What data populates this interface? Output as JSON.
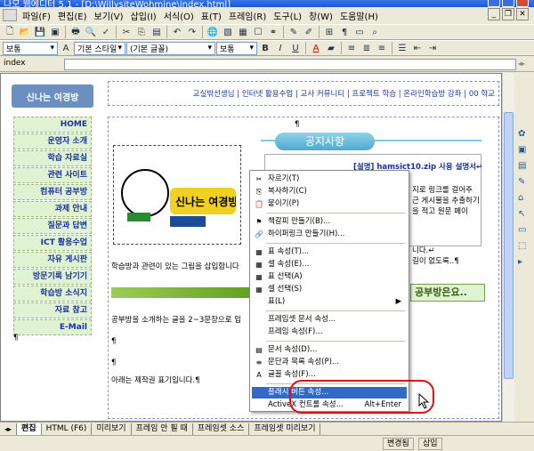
{
  "window": {
    "title": "나모 웹에디터 5.1 - [D:\\WillysiteWohmine\\index.html]"
  },
  "menu": [
    "파일(F)",
    "편집(E)",
    "보기(V)",
    "삽입(I)",
    "서식(O)",
    "표(T)",
    "프레임(R)",
    "도구(L)",
    "창(W)",
    "도움말(H)"
  ],
  "format": {
    "style": "보통",
    "font_style": "기본 스타일",
    "font": "(기본 글꼴)",
    "size": "보통",
    "bold": "B",
    "italic": "I",
    "underline": "U",
    "text_color": "A"
  },
  "address": {
    "name": "index"
  },
  "site": {
    "logo": "신나는 여경방",
    "topnav": "교실밖선생님 | 인터넷 활용수업 | 교사 커뮤니티 | 프로젝트 학습 | 온라인학습방 강좌 | 00 학교",
    "nav": [
      "HOME",
      "운영자 소개",
      "학습 자료실",
      "관련 사이트",
      "컴퓨터 공부방",
      "과제 안내",
      "질문과 답변",
      "ICT 활용수업",
      "자유 게시판",
      "방문기록 남기기",
      "학습방 소식지",
      "자료 참고",
      "E-Mail"
    ],
    "img_caption": "신나는 여경방",
    "notice_title": "공지사항",
    "notice_heading": "[설명] hamsict10.zip 사용 설명서↵",
    "notice_lines": [
      "지로 링크를 걸어주",
      "근 게시물을 추출하기",
      "을 적고 원문 페이",
      "니다.↵",
      "길이 없도록..¶"
    ],
    "text_img": "학습방과 관련이 있는 그림을 삽입합니다",
    "text_intro": "공부방을 소개하는 글을 2~3문장으로 입",
    "text_author": "아래는 제작권 표기입니다.¶",
    "banner": "공부방은요..",
    "para": "¶"
  },
  "context_menu": {
    "items": [
      {
        "label": "자르기(T)",
        "icon": "scissors-icon",
        "glyph": "✂"
      },
      {
        "label": "복사하기(C)",
        "icon": "copy-icon",
        "glyph": "⎘"
      },
      {
        "label": "붙이기(P)",
        "icon": "paste-icon",
        "glyph": "📋"
      },
      {
        "label": "책갈피 만들기(B)...",
        "icon": "bookmark-icon",
        "glyph": "⚑"
      },
      {
        "label": "하이퍼링크 만들기(H)...",
        "icon": "link-icon",
        "glyph": "🔗"
      },
      {
        "label": "표 속성(T)...",
        "icon": "table-props-icon",
        "glyph": "▦"
      },
      {
        "label": "셀 속성(E)...",
        "icon": "cell-props-icon",
        "glyph": "▦"
      },
      {
        "label": "표 선택(A)",
        "icon": "table-select-icon",
        "glyph": "▦"
      },
      {
        "label": "셀 선택(S)",
        "icon": "cell-select-icon",
        "glyph": "▦"
      },
      {
        "label": "표(L)",
        "icon": "",
        "glyph": "",
        "submenu": "▶"
      },
      {
        "label": "프레임셋 문서 속성...",
        "icon": "",
        "glyph": ""
      },
      {
        "label": "프레임 속성(F)...",
        "icon": "",
        "glyph": ""
      },
      {
        "label": "문서 속성(D)...",
        "icon": "doc-props-icon",
        "glyph": "▤"
      },
      {
        "label": "문단과 목록 속성(P)...",
        "icon": "paragraph-icon",
        "glyph": "≡"
      },
      {
        "label": "글꼴 속성(F)...",
        "icon": "font-icon",
        "glyph": "A"
      },
      {
        "label": "플래시 버튼 속성...",
        "icon": "",
        "glyph": ""
      },
      {
        "label": "ActiveX 컨트롤 속성...",
        "icon": "",
        "glyph": "",
        "shortcut": "Alt+Enter"
      }
    ]
  },
  "tabs": [
    "편집",
    "HTML (F6)",
    "미리보기",
    "프레임 안 필 때",
    "프레임셋 소스",
    "프레임셋 미리보기"
  ],
  "status": {
    "mode": "변경됨",
    "insert": "삽입"
  },
  "colors": {
    "accent": "#316ac5",
    "highlight_circle": "#e01010"
  }
}
